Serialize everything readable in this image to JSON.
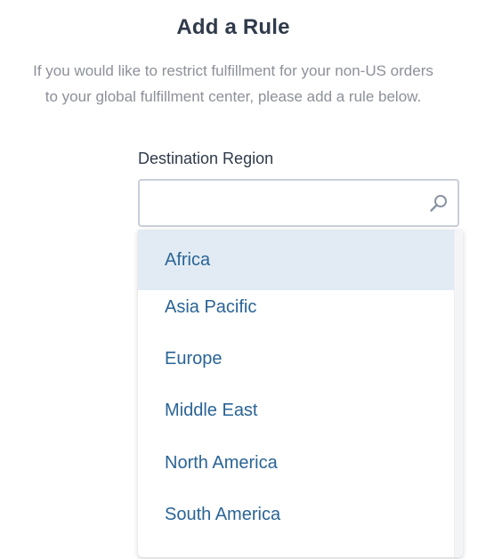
{
  "header": {
    "title": "Add a Rule",
    "subtitle_line1": "If you would like to restrict fulfillment for your non-US orders",
    "subtitle_line2": "to your global fulfillment center, please add a rule below."
  },
  "destination_region": {
    "label": "Destination Region",
    "value": "",
    "placeholder": "",
    "icon": "search-icon",
    "options": [
      {
        "label": "Africa",
        "highlighted": true
      },
      {
        "label": "Asia Pacific",
        "highlighted": false
      },
      {
        "label": "Europe",
        "highlighted": false
      },
      {
        "label": "Middle East",
        "highlighted": false
      },
      {
        "label": "North America",
        "highlighted": false
      },
      {
        "label": "South America",
        "highlighted": false
      }
    ]
  },
  "colors": {
    "title": "#2f3a4a",
    "subtitle": "#8c9098",
    "option_text": "#2a6496",
    "option_highlight": "#e2ebf3",
    "input_border": "#c9ced8"
  }
}
